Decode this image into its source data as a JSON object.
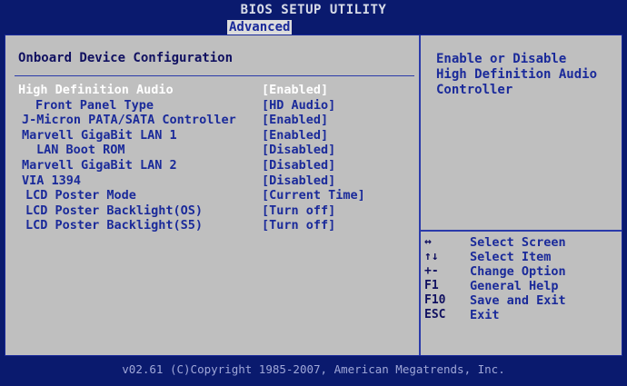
{
  "header": {
    "title": "BIOS SETUP UTILITY",
    "active_tab": "Advanced"
  },
  "section": {
    "title": "Onboard Device Configuration"
  },
  "items": [
    {
      "label": "High Definition Audio",
      "value": "[Enabled]"
    },
    {
      "label": "Front Panel Type",
      "value": "[HD Audio]"
    },
    {
      "label": "J-Micron PATA/SATA Controller",
      "value": "[Enabled]"
    },
    {
      "label": "Marvell GigaBit LAN 1",
      "value": "[Enabled]"
    },
    {
      "label": "LAN Boot ROM",
      "value": "[Disabled]"
    },
    {
      "label": "Marvell GigaBit LAN 2",
      "value": "[Disabled]"
    },
    {
      "label": "VIA 1394",
      "value": "[Disabled]"
    },
    {
      "label": "LCD Poster Mode",
      "value": "[Current Time]"
    },
    {
      "label": "LCD Poster Backlight(OS)",
      "value": "[Turn off]"
    },
    {
      "label": "LCD Poster Backlight(S5)",
      "value": "[Turn off]"
    }
  ],
  "help": {
    "lines": [
      "Enable or Disable",
      "High Definition Audio",
      "Controller"
    ]
  },
  "keys": [
    {
      "key": "↔",
      "desc": "Select Screen"
    },
    {
      "key": "↑↓",
      "desc": "Select Item"
    },
    {
      "key": "+-",
      "desc": "Change Option"
    },
    {
      "key": "F1",
      "desc": "General Help"
    },
    {
      "key": "F10",
      "desc": "Save and Exit"
    },
    {
      "key": "ESC",
      "desc": "Exit"
    }
  ],
  "footer": {
    "text": "v02.61 (C)Copyright 1985-2007, American Megatrends, Inc."
  },
  "colors": {
    "background": "#0a1a6e",
    "panel": "#bfbfbf",
    "text": "#1a2a9a",
    "selected_text": "#ffffff"
  }
}
